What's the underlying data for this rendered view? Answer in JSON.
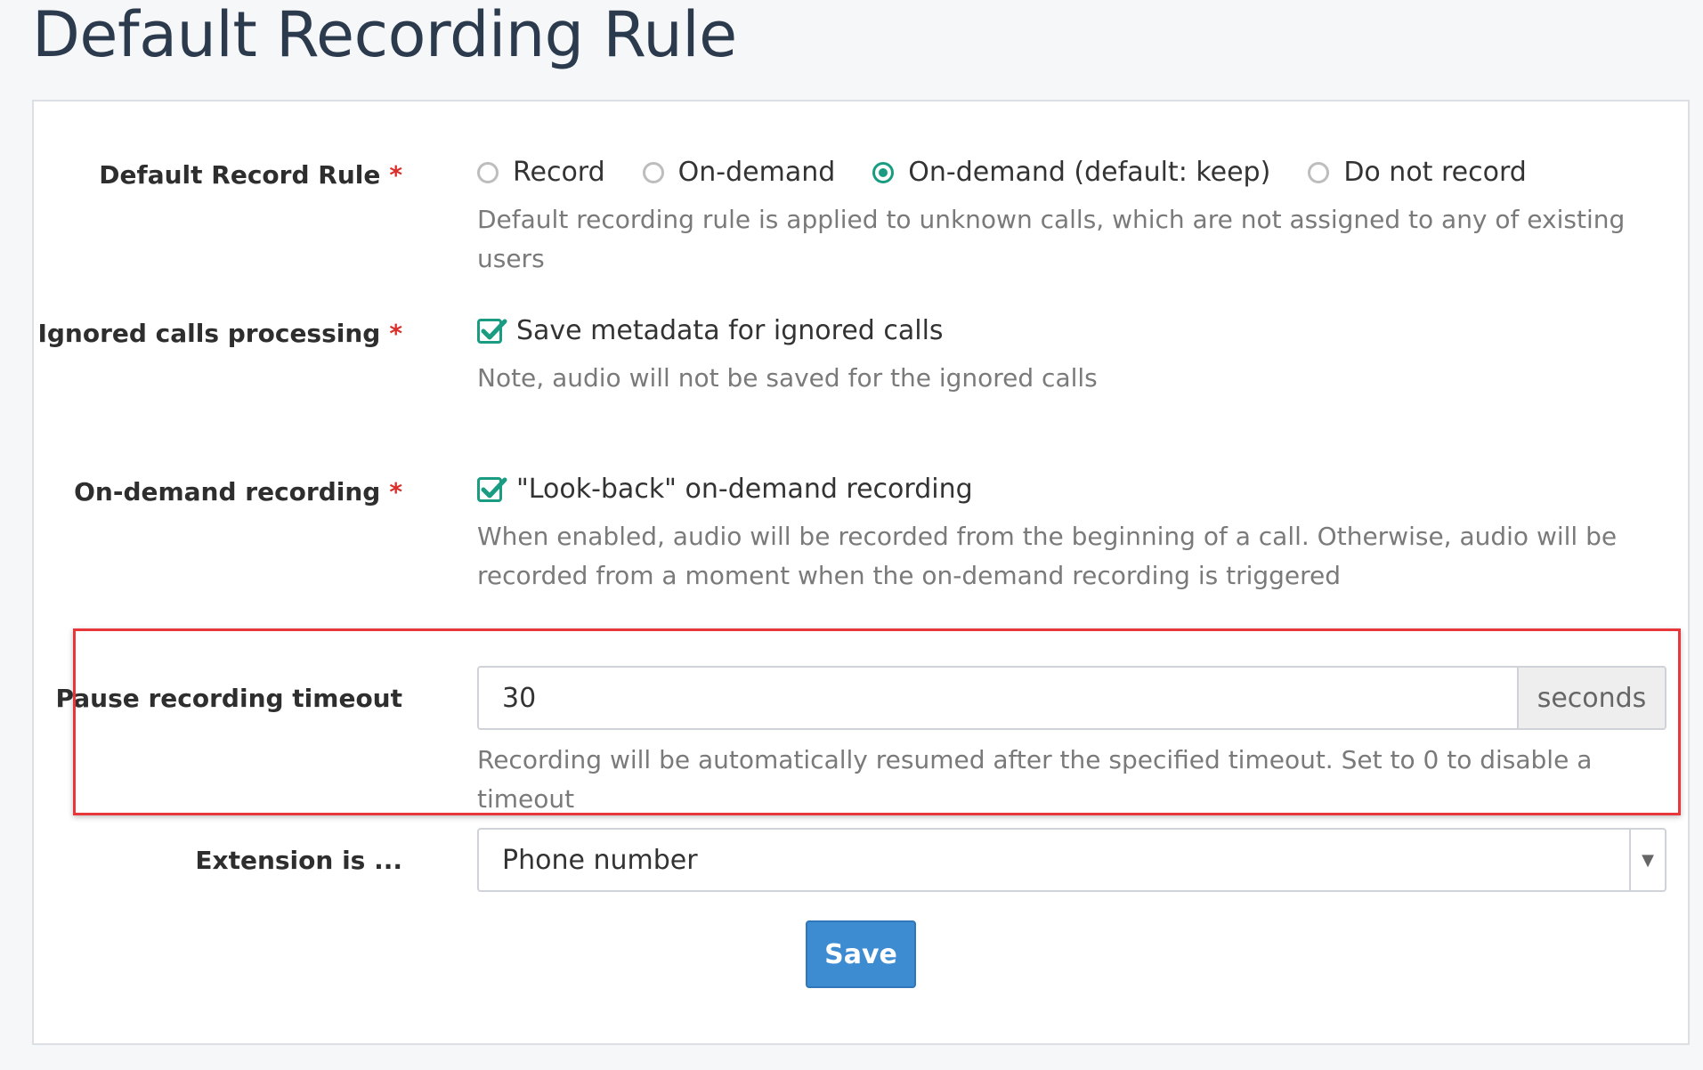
{
  "page": {
    "title": "Default Recording Rule"
  },
  "record_rule": {
    "label": "Default Record Rule",
    "required_mark": "*",
    "options": [
      {
        "label": "Record",
        "checked": false
      },
      {
        "label": "On-demand",
        "checked": false
      },
      {
        "label": "On-demand (default: keep)",
        "checked": true
      },
      {
        "label": "Do not record",
        "checked": false
      }
    ],
    "help": "Default recording rule is applied to unknown calls, which are not assigned to any of existing users"
  },
  "ignored_calls": {
    "label": "Ignored calls processing",
    "required_mark": "*",
    "checkbox_label": "Save metadata for ignored calls",
    "checked": true,
    "help": "Note, audio will not be saved for the ignored calls"
  },
  "on_demand": {
    "label": "On-demand recording",
    "required_mark": "*",
    "checkbox_label": "\"Look-back\" on-demand recording",
    "checked": true,
    "help_line1": "When enabled, audio will be recorded from the beginning of a call. Otherwise, audio will be",
    "help_line2": "recorded from a moment when the on-demand recording is triggered"
  },
  "pause_timeout": {
    "label": "Pause recording timeout",
    "value": "30",
    "unit": "seconds",
    "help": "Recording will be automatically resumed after the specified timeout. Set to 0 to disable a timeout"
  },
  "extension": {
    "label": "Extension is ...",
    "selected": "Phone number"
  },
  "actions": {
    "save_label": "Save"
  },
  "colors": {
    "accent": "#1a9c83",
    "primary_button": "#3d8bd1",
    "highlight_border": "#e8373a",
    "required": "#d9302c"
  }
}
